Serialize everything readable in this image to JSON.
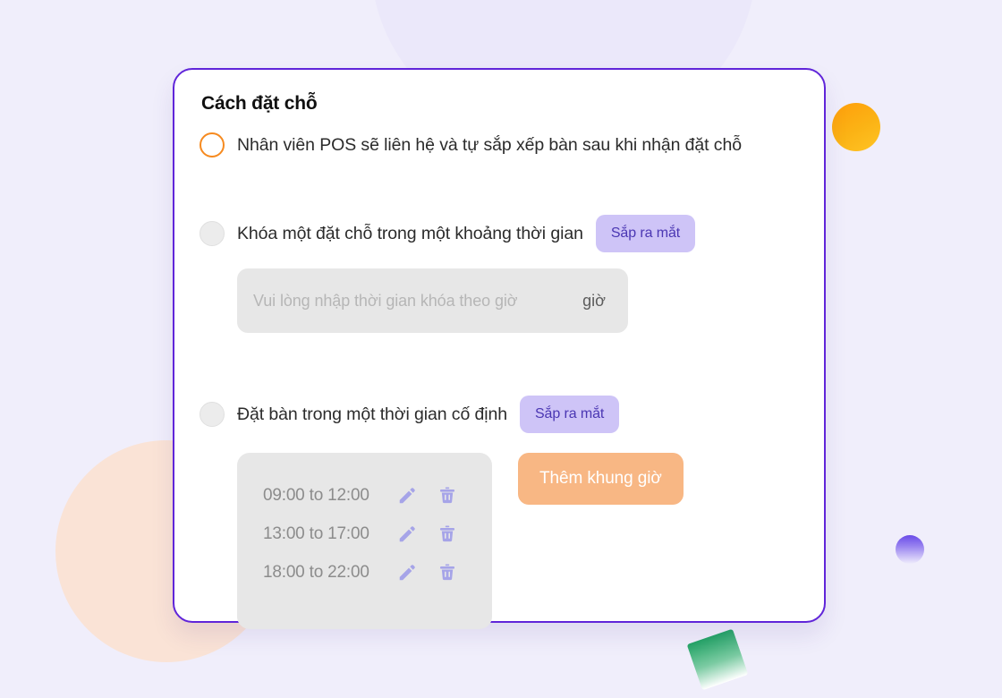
{
  "card": {
    "title": "Cách đặt chỗ",
    "options": [
      {
        "id": "staff-arrange",
        "label": "Nhân viên POS sẽ liên hệ và tự sắp xếp bàn sau khi nhận đặt chỗ",
        "selected": true,
        "badge": null
      },
      {
        "id": "lock-duration",
        "label": "Khóa một đặt chỗ trong một khoảng thời gian",
        "selected": false,
        "badge": "Sắp ra mắt"
      },
      {
        "id": "fixed-timeframe",
        "label": "Đặt bàn trong một thời gian cố định",
        "selected": false,
        "badge": "Sắp ra mắt"
      }
    ],
    "lock_input": {
      "placeholder": "Vui lòng nhập thời gian khóa theo giờ",
      "value": "",
      "suffix": "giờ"
    },
    "time_slots": [
      {
        "label": "09:00 to 12:00",
        "edit_icon": "pencil-icon",
        "delete_icon": "trash-icon"
      },
      {
        "label": "13:00 to 17:00",
        "edit_icon": "pencil-icon",
        "delete_icon": "trash-icon"
      },
      {
        "label": "18:00 to 22:00",
        "edit_icon": "pencil-icon",
        "delete_icon": "trash-icon"
      }
    ],
    "add_slot_label": "Thêm khung giờ"
  },
  "colors": {
    "page_background": "#F0EEFB",
    "card_border": "#6025D9",
    "accent_orange": "#F68A1F",
    "badge_background": "#CEC4F7",
    "badge_text": "#4B37B3",
    "add_button": "#F8B784",
    "icon_purple": "#A6A4E8",
    "field_background": "#E7E7E7",
    "deco_peach": "#FAE3D6",
    "deco_green": "#23A465"
  }
}
